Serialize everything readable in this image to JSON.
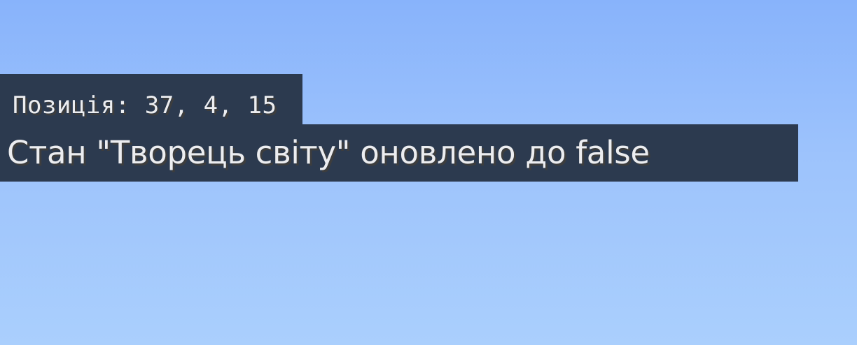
{
  "chat": {
    "position_message": "Позиція: 37, 4, 15",
    "status_message": "Стан \"Творець світу\" оновлено до false"
  },
  "colors": {
    "sky_top": "#88b3fb",
    "sky_bottom": "#aacffd",
    "chat_background": "#263346",
    "chat_text": "#ecedf0"
  }
}
